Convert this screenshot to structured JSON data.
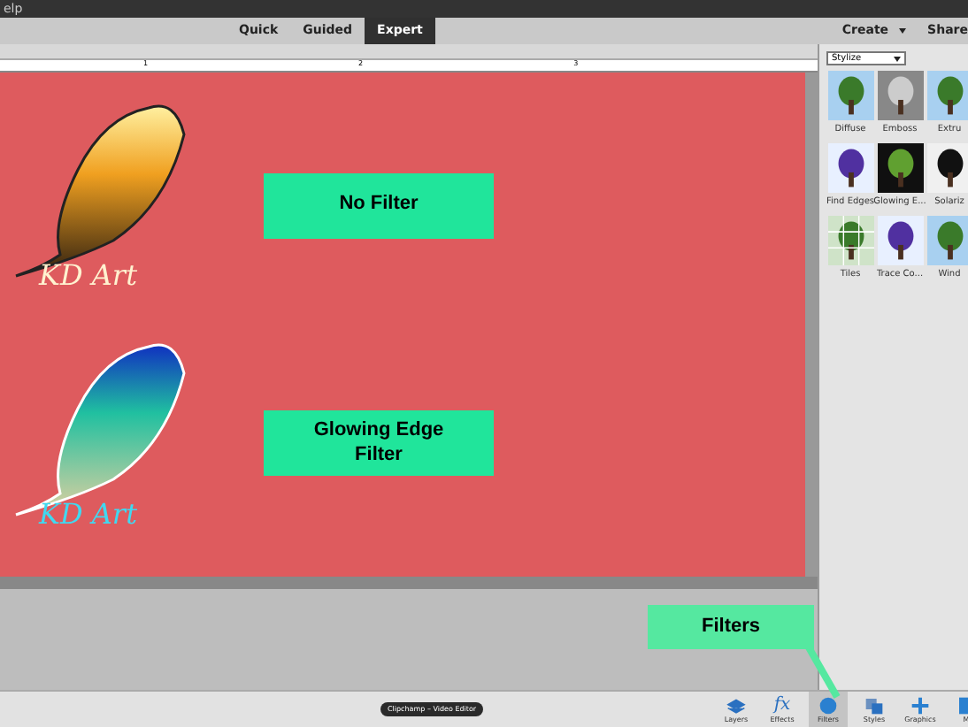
{
  "title_bar": {
    "text": "elp"
  },
  "modes": [
    {
      "label": "Quick",
      "selected": false
    },
    {
      "label": "Guided",
      "selected": false
    },
    {
      "label": "Expert",
      "selected": true
    }
  ],
  "top_actions": [
    {
      "label": "Create",
      "caret": true
    },
    {
      "label": "Share",
      "caret": false
    }
  ],
  "ruler": [
    "1",
    "2",
    "3"
  ],
  "canvas": {
    "artworks": [
      {
        "kind": "plain",
        "logo_text": "KD Art",
        "label": "No Filter"
      },
      {
        "kind": "glowing",
        "logo_text": "KD Art",
        "label": "Glowing Edge Filter"
      }
    ]
  },
  "filters_panel": {
    "category": "Stylize",
    "thumbnails": [
      {
        "label": "Diffuse",
        "kind": "plain"
      },
      {
        "label": "Emboss",
        "kind": "emboss"
      },
      {
        "label": "Extru",
        "kind": "plain"
      },
      {
        "label": "Find Edges",
        "kind": "edges"
      },
      {
        "label": "Glowing E...",
        "kind": "glow"
      },
      {
        "label": "Solariz",
        "kind": "dark"
      },
      {
        "label": "Tiles",
        "kind": "tiles"
      },
      {
        "label": "Trace Co...",
        "kind": "edges"
      },
      {
        "label": "Wind",
        "kind": "plain"
      }
    ]
  },
  "callout": {
    "text": "Filters"
  },
  "taskbar_tooltip": {
    "text": "Clipchamp – Video Editor"
  },
  "panel_buttons": [
    {
      "label": "Layers",
      "selected": false
    },
    {
      "label": "Effects",
      "selected": false,
      "glyph": "fx"
    },
    {
      "label": "Filters",
      "selected": true
    },
    {
      "label": "Styles",
      "selected": false
    },
    {
      "label": "Graphics",
      "selected": false
    },
    {
      "label": "M",
      "selected": false
    }
  ]
}
